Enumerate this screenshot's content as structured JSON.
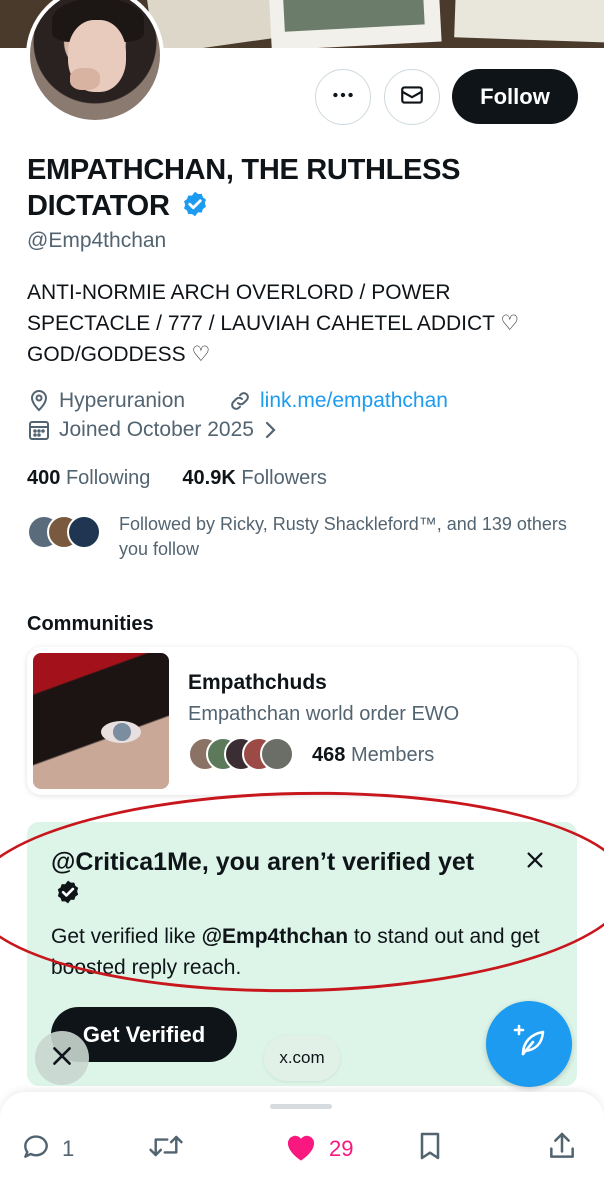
{
  "profile": {
    "name": "EMPATHCHAN, THE RUTHLESS DICTATOR",
    "handle": "@Emp4thchan",
    "bio_lines": [
      "ANTI-NORMIE ARCH OVERLORD / POWER",
      "SPECTACLE / 777 / LAUVIAH CAHETEL ADDICT ♡",
      "GOD/GODDESS ♡"
    ],
    "location": "Hyperuranion",
    "link": "link.me/empathchan",
    "joined": "Joined October 2025",
    "following_count": "400",
    "following_label": "Following",
    "followers_count": "40.9K",
    "followers_label": "Followers",
    "followed_by": "Followed by Ricky, Rusty Shackleford™, and 139 others you follow"
  },
  "actions": {
    "follow_label": "Follow"
  },
  "communities": {
    "title": "Communities",
    "items": [
      {
        "name": "Empathchuds",
        "description": "Empathchan world order EWO",
        "member_count": "468",
        "member_label": "Members"
      }
    ]
  },
  "verify_prompt": {
    "title": "@Critica1Me, you aren’t verified yet",
    "body_pre": "Get verified like ",
    "body_handle": "@Emp4thchan",
    "body_post": " to stand out and get boosted reply reach.",
    "button_label": "Get Verified"
  },
  "browser": {
    "url": "x.com"
  },
  "post_actions": {
    "reply_count": "1",
    "like_count": "29"
  },
  "colors": {
    "accent": "#1d9bf0",
    "like": "#f91880",
    "verify_card_bg": "#ddf5e8",
    "annotation": "#c8161d"
  },
  "icons": [
    "more-icon",
    "mail-icon",
    "verified-badge-icon",
    "location-icon",
    "link-icon",
    "calendar-icon",
    "chevron-right-icon",
    "close-icon",
    "compose-icon",
    "reply-icon",
    "repost-icon",
    "heart-icon",
    "bookmark-icon",
    "share-icon"
  ]
}
